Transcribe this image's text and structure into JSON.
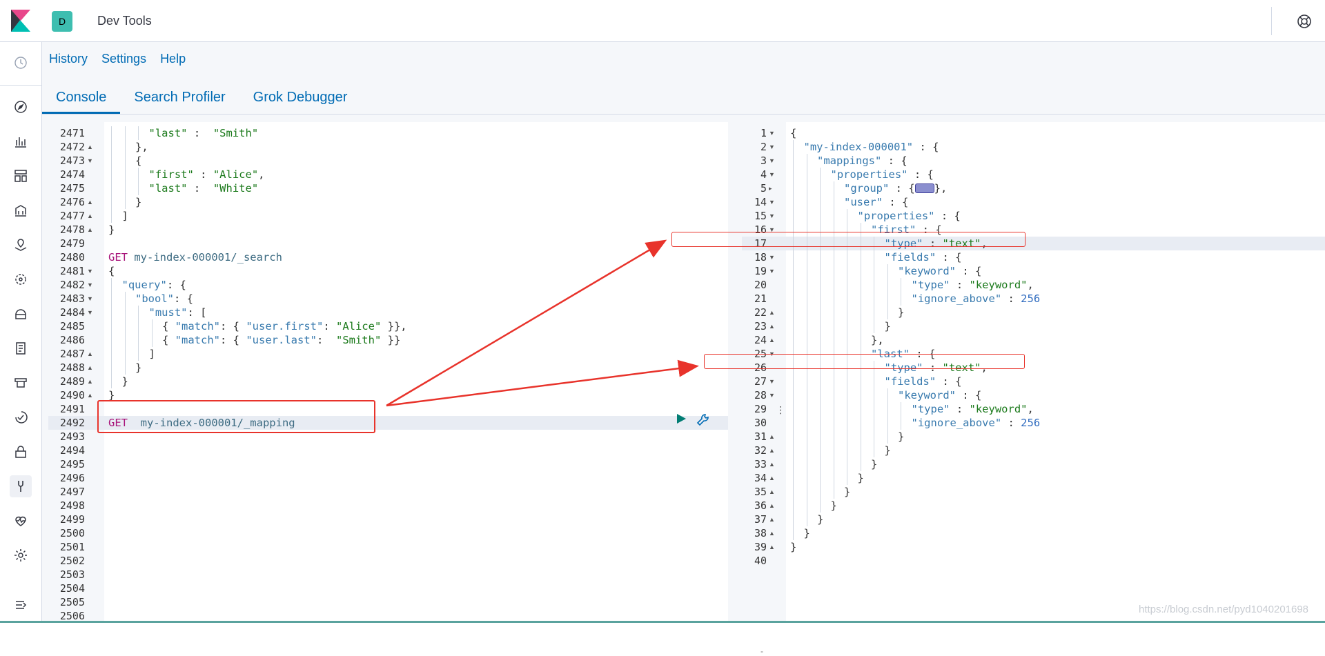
{
  "header": {
    "space_initial": "D",
    "app_title": "Dev Tools"
  },
  "topnav": [
    "History",
    "Settings",
    "Help"
  ],
  "tabs": [
    "Console",
    "Search Profiler",
    "Grok Debugger"
  ],
  "sidebar": [
    "clock-icon",
    "compass-icon",
    "chart-icon",
    "dashboard-icon",
    "canvas-icon",
    "maps-icon",
    "ml-icon",
    "infra-icon",
    "logs-icon",
    "apm-icon",
    "uptime-icon",
    "siem-icon",
    "dev-tools-icon",
    "monitoring-icon",
    "settings-icon",
    "collapse-icon"
  ],
  "left_editor": {
    "lines": [
      {
        "n": "2471",
        "fold": "",
        "indent": 3,
        "tokens": [
          [
            "s",
            "\"last\""
          ],
          [
            "p",
            " :  "
          ],
          [
            "s",
            "\"Smith\""
          ]
        ]
      },
      {
        "n": "2472",
        "fold": "up",
        "indent": 2,
        "tokens": [
          [
            "p",
            "},"
          ]
        ]
      },
      {
        "n": "2473",
        "fold": "down",
        "indent": 2,
        "tokens": [
          [
            "p",
            "{"
          ]
        ]
      },
      {
        "n": "2474",
        "fold": "",
        "indent": 3,
        "tokens": [
          [
            "s",
            "\"first\""
          ],
          [
            "p",
            " : "
          ],
          [
            "s",
            "\"Alice\""
          ],
          [
            "p",
            ","
          ]
        ]
      },
      {
        "n": "2475",
        "fold": "",
        "indent": 3,
        "tokens": [
          [
            "s",
            "\"last\""
          ],
          [
            "p",
            " :  "
          ],
          [
            "s",
            "\"White\""
          ]
        ]
      },
      {
        "n": "2476",
        "fold": "up",
        "indent": 2,
        "tokens": [
          [
            "p",
            "}"
          ]
        ]
      },
      {
        "n": "2477",
        "fold": "up",
        "indent": 1,
        "tokens": [
          [
            "p",
            "]"
          ]
        ]
      },
      {
        "n": "2478",
        "fold": "up",
        "indent": 0,
        "tokens": [
          [
            "p",
            "}"
          ]
        ]
      },
      {
        "n": "2479",
        "fold": "",
        "indent": 0,
        "tokens": []
      },
      {
        "n": "2480",
        "fold": "",
        "indent": 0,
        "tokens": [
          [
            "m",
            "GET"
          ],
          [
            "u",
            " my-index-000001/_search"
          ]
        ]
      },
      {
        "n": "2481",
        "fold": "down",
        "indent": 0,
        "tokens": [
          [
            "p",
            "{"
          ]
        ]
      },
      {
        "n": "2482",
        "fold": "down",
        "indent": 1,
        "tokens": [
          [
            "k",
            "\"query\""
          ],
          [
            "p",
            ": {"
          ]
        ]
      },
      {
        "n": "2483",
        "fold": "down",
        "indent": 2,
        "tokens": [
          [
            "k",
            "\"bool\""
          ],
          [
            "p",
            ": {"
          ]
        ]
      },
      {
        "n": "2484",
        "fold": "down",
        "indent": 3,
        "tokens": [
          [
            "k",
            "\"must\""
          ],
          [
            "p",
            ": ["
          ]
        ]
      },
      {
        "n": "2485",
        "fold": "",
        "indent": 4,
        "tokens": [
          [
            "p",
            "{ "
          ],
          [
            "k",
            "\"match\""
          ],
          [
            "p",
            ": { "
          ],
          [
            "k",
            "\"user.first\""
          ],
          [
            "p",
            ": "
          ],
          [
            "s",
            "\"Alice\""
          ],
          [
            "p",
            " }},"
          ]
        ]
      },
      {
        "n": "2486",
        "fold": "",
        "indent": 4,
        "tokens": [
          [
            "p",
            "{ "
          ],
          [
            "k",
            "\"match\""
          ],
          [
            "p",
            ": { "
          ],
          [
            "k",
            "\"user.last\""
          ],
          [
            "p",
            ":  "
          ],
          [
            "s",
            "\"Smith\""
          ],
          [
            "p",
            " }}"
          ]
        ]
      },
      {
        "n": "2487",
        "fold": "up",
        "indent": 3,
        "tokens": [
          [
            "p",
            "]"
          ]
        ]
      },
      {
        "n": "2488",
        "fold": "up",
        "indent": 2,
        "tokens": [
          [
            "p",
            "}"
          ]
        ]
      },
      {
        "n": "2489",
        "fold": "up",
        "indent": 1,
        "tokens": [
          [
            "p",
            "}"
          ]
        ]
      },
      {
        "n": "2490",
        "fold": "up",
        "indent": 0,
        "tokens": [
          [
            "p",
            "}"
          ]
        ]
      },
      {
        "n": "2491",
        "fold": "",
        "indent": 0,
        "tokens": []
      },
      {
        "n": "2492",
        "fold": "",
        "indent": 0,
        "tokens": [
          [
            "m",
            "GET"
          ],
          [
            "u",
            "  my-index-000001/_mapping"
          ]
        ]
      },
      {
        "n": "2493",
        "fold": "",
        "indent": 0,
        "tokens": []
      },
      {
        "n": "2494",
        "fold": "",
        "indent": 0,
        "tokens": []
      },
      {
        "n": "2495",
        "fold": "",
        "indent": 0,
        "tokens": []
      },
      {
        "n": "2496",
        "fold": "",
        "indent": 0,
        "tokens": []
      },
      {
        "n": "2497",
        "fold": "",
        "indent": 0,
        "tokens": []
      },
      {
        "n": "2498",
        "fold": "",
        "indent": 0,
        "tokens": []
      },
      {
        "n": "2499",
        "fold": "",
        "indent": 0,
        "tokens": []
      },
      {
        "n": "2500",
        "fold": "",
        "indent": 0,
        "tokens": []
      },
      {
        "n": "2501",
        "fold": "",
        "indent": 0,
        "tokens": []
      },
      {
        "n": "2502",
        "fold": "",
        "indent": 0,
        "tokens": []
      },
      {
        "n": "2503",
        "fold": "",
        "indent": 0,
        "tokens": []
      },
      {
        "n": "2504",
        "fold": "",
        "indent": 0,
        "tokens": []
      },
      {
        "n": "2505",
        "fold": "",
        "indent": 0,
        "tokens": []
      },
      {
        "n": "2506",
        "fold": "",
        "indent": 0,
        "tokens": []
      }
    ],
    "active_line": "2492"
  },
  "right_editor": {
    "lines": [
      {
        "n": "1",
        "fold": "down",
        "indent": 0,
        "tokens": [
          [
            "p",
            "{"
          ]
        ]
      },
      {
        "n": "2",
        "fold": "down",
        "indent": 1,
        "tokens": [
          [
            "k",
            "\"my-index-000001\""
          ],
          [
            "p",
            " : {"
          ]
        ]
      },
      {
        "n": "3",
        "fold": "down",
        "indent": 2,
        "tokens": [
          [
            "k",
            "\"mappings\""
          ],
          [
            "p",
            " : {"
          ]
        ]
      },
      {
        "n": "4",
        "fold": "down",
        "indent": 3,
        "tokens": [
          [
            "k",
            "\"properties\""
          ],
          [
            "p",
            " : {"
          ]
        ]
      },
      {
        "n": "5",
        "fold": "right",
        "indent": 4,
        "tokens": [
          [
            "k",
            "\"group\""
          ],
          [
            "p",
            " : {"
          ],
          [
            "fold",
            ""
          ],
          [
            "p",
            "},"
          ]
        ]
      },
      {
        "n": "14",
        "fold": "down",
        "indent": 4,
        "tokens": [
          [
            "k",
            "\"user\""
          ],
          [
            "p",
            " : {"
          ]
        ]
      },
      {
        "n": "15",
        "fold": "down",
        "indent": 5,
        "tokens": [
          [
            "k",
            "\"properties\""
          ],
          [
            "p",
            " : {"
          ]
        ]
      },
      {
        "n": "16",
        "fold": "down",
        "indent": 6,
        "tokens": [
          [
            "k",
            "\"first\""
          ],
          [
            "p",
            " : {"
          ]
        ]
      },
      {
        "n": "17",
        "fold": "",
        "indent": 7,
        "tokens": [
          [
            "k",
            "\"type\""
          ],
          [
            "p",
            " : "
          ],
          [
            "s",
            "\"text\""
          ],
          [
            "p",
            ","
          ]
        ]
      },
      {
        "n": "18",
        "fold": "down",
        "indent": 7,
        "tokens": [
          [
            "k",
            "\"fields\""
          ],
          [
            "p",
            " : {"
          ]
        ]
      },
      {
        "n": "19",
        "fold": "down",
        "indent": 8,
        "tokens": [
          [
            "k",
            "\"keyword\""
          ],
          [
            "p",
            " : {"
          ]
        ]
      },
      {
        "n": "20",
        "fold": "",
        "indent": 9,
        "tokens": [
          [
            "k",
            "\"type\""
          ],
          [
            "p",
            " : "
          ],
          [
            "s",
            "\"keyword\""
          ],
          [
            "p",
            ","
          ]
        ]
      },
      {
        "n": "21",
        "fold": "",
        "indent": 9,
        "tokens": [
          [
            "k",
            "\"ignore_above\""
          ],
          [
            "p",
            " : "
          ],
          [
            "n",
            "256"
          ]
        ]
      },
      {
        "n": "22",
        "fold": "up",
        "indent": 8,
        "tokens": [
          [
            "p",
            "}"
          ]
        ]
      },
      {
        "n": "23",
        "fold": "up",
        "indent": 7,
        "tokens": [
          [
            "p",
            "}"
          ]
        ]
      },
      {
        "n": "24",
        "fold": "up",
        "indent": 6,
        "tokens": [
          [
            "p",
            "},"
          ]
        ]
      },
      {
        "n": "25",
        "fold": "down",
        "indent": 6,
        "tokens": [
          [
            "k",
            "\"last\""
          ],
          [
            "p",
            " : {"
          ]
        ]
      },
      {
        "n": "26",
        "fold": "",
        "indent": 7,
        "tokens": [
          [
            "k",
            "\"type\""
          ],
          [
            "p",
            " : "
          ],
          [
            "s",
            "\"text\""
          ],
          [
            "p",
            ","
          ]
        ]
      },
      {
        "n": "27",
        "fold": "down",
        "indent": 7,
        "tokens": [
          [
            "k",
            "\"fields\""
          ],
          [
            "p",
            " : {"
          ]
        ]
      },
      {
        "n": "28",
        "fold": "down",
        "indent": 8,
        "tokens": [
          [
            "k",
            "\"keyword\""
          ],
          [
            "p",
            " : {"
          ]
        ]
      },
      {
        "n": "29",
        "fold": "",
        "indent": 9,
        "tokens": [
          [
            "k",
            "\"type\""
          ],
          [
            "p",
            " : "
          ],
          [
            "s",
            "\"keyword\""
          ],
          [
            "p",
            ","
          ]
        ]
      },
      {
        "n": "30",
        "fold": "",
        "indent": 9,
        "tokens": [
          [
            "k",
            "\"ignore_above\""
          ],
          [
            "p",
            " : "
          ],
          [
            "n",
            "256"
          ]
        ]
      },
      {
        "n": "31",
        "fold": "up",
        "indent": 8,
        "tokens": [
          [
            "p",
            "}"
          ]
        ]
      },
      {
        "n": "32",
        "fold": "up",
        "indent": 7,
        "tokens": [
          [
            "p",
            "}"
          ]
        ]
      },
      {
        "n": "33",
        "fold": "up",
        "indent": 6,
        "tokens": [
          [
            "p",
            "}"
          ]
        ]
      },
      {
        "n": "34",
        "fold": "up",
        "indent": 5,
        "tokens": [
          [
            "p",
            "}"
          ]
        ]
      },
      {
        "n": "35",
        "fold": "up",
        "indent": 4,
        "tokens": [
          [
            "p",
            "}"
          ]
        ]
      },
      {
        "n": "36",
        "fold": "up",
        "indent": 3,
        "tokens": [
          [
            "p",
            "}"
          ]
        ]
      },
      {
        "n": "37",
        "fold": "up",
        "indent": 2,
        "tokens": [
          [
            "p",
            "}"
          ]
        ]
      },
      {
        "n": "38",
        "fold": "up",
        "indent": 1,
        "tokens": [
          [
            "p",
            "}"
          ]
        ]
      },
      {
        "n": "39",
        "fold": "up",
        "indent": 0,
        "tokens": [
          [
            "p",
            "}"
          ]
        ]
      },
      {
        "n": "40",
        "fold": "",
        "indent": 0,
        "tokens": []
      }
    ],
    "active_line": "17"
  },
  "watermark": "https://blog.csdn.net/pyd1040201698",
  "colors": {
    "accent": "#006bb4",
    "annotation": "#e8332b",
    "space_badge": "#3ebeb0"
  }
}
